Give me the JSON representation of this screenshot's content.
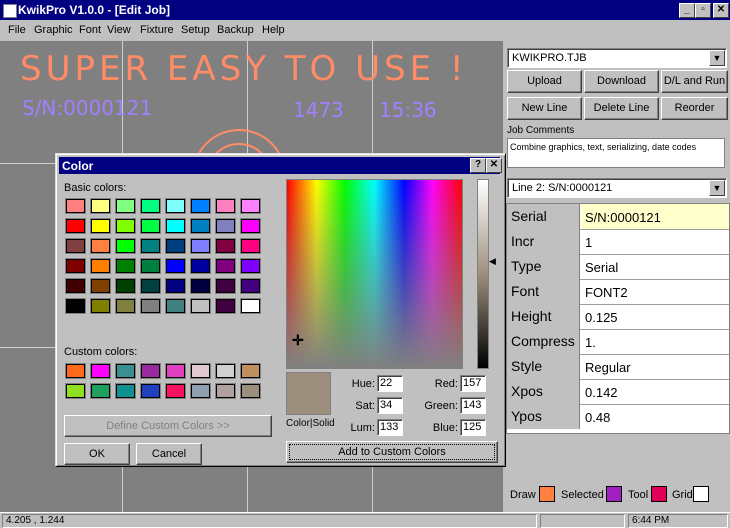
{
  "window": {
    "title": "KwikPro  V1.0.0 - [Edit Job]",
    "controls": [
      "_",
      "\b",
      "X"
    ]
  },
  "menu": [
    "File",
    "Graphic",
    "Font",
    "View",
    "Fixture",
    "Setup",
    "Backup",
    "Help"
  ],
  "canvas": {
    "headline": "SUPER EASY  TO  USE  !",
    "serial_text": "S/N:0000121",
    "count_text": "1473",
    "time_text": "15:36"
  },
  "panel": {
    "file_combo": "KWIKPRO.TJB",
    "buttons": {
      "upload": "Upload",
      "download": "Download",
      "dl_run": "D/L and Run",
      "new_line": "New Line",
      "delete_line": "Delete Line",
      "reorder": "Reorder"
    },
    "job_comments_label": "Job Comments",
    "job_comments": "Combine graphics, text, serializing, date codes",
    "line_combo": "Line 2: S/N:0000121",
    "properties": [
      {
        "name": "Serial",
        "value": "S/N:0000121"
      },
      {
        "name": "Incr",
        "value": "1"
      },
      {
        "name": "Type",
        "value": "Serial"
      },
      {
        "name": "Font",
        "value": "FONT2"
      },
      {
        "name": "Height",
        "value": "0.125"
      },
      {
        "name": "Compress",
        "value": "1."
      },
      {
        "name": "Style",
        "value": "Regular"
      },
      {
        "name": "Xpos",
        "value": "0.142"
      },
      {
        "name": "Ypos",
        "value": "0.48"
      }
    ],
    "legend": {
      "draw": "Draw",
      "selected": "Selected",
      "tool": "Tool",
      "grid": "Grid",
      "draw_color": "#ff8040",
      "selected_color": "#a020c0",
      "tool_color": "#e0005a",
      "grid_color": "#ffffff"
    }
  },
  "color_dialog": {
    "title": "Color",
    "basic_label": "Basic colors:",
    "custom_label": "Custom colors:",
    "basic_colors": [
      "#ff8080",
      "#ffff80",
      "#80ff80",
      "#00ff80",
      "#80ffff",
      "#0080ff",
      "#ff80c0",
      "#ff80ff",
      "#ff0000",
      "#ffff00",
      "#80ff00",
      "#00ff40",
      "#00ffff",
      "#0080c0",
      "#8080c0",
      "#ff00ff",
      "#804040",
      "#ff8040",
      "#00ff00",
      "#008080",
      "#004080",
      "#8080ff",
      "#800040",
      "#ff0080",
      "#800000",
      "#ff8000",
      "#008000",
      "#008040",
      "#0000ff",
      "#0000a0",
      "#800080",
      "#8000ff",
      "#400000",
      "#804000",
      "#004000",
      "#004040",
      "#000080",
      "#000040",
      "#400040",
      "#400080",
      "#000000",
      "#808000",
      "#808040",
      "#808080",
      "#408080",
      "#c0c0c0",
      "#400040",
      "#ffffff"
    ],
    "custom_colors": [
      "#ff6a1a",
      "#ff00ff",
      "#3a9090",
      "#9a2aa0",
      "#e040c0",
      "#e0c8d0",
      "#d0d0d0",
      "#c09060",
      "#90e020",
      "#20a060",
      "#109090",
      "#2040c0",
      "#ff1060",
      "#90a0b0",
      "#b0a0a0",
      "#9d8f7d"
    ],
    "define_button": "Define Custom Colors >>",
    "ok_button": "OK",
    "cancel_button": "Cancel",
    "color_solid_label": "Color|Solid",
    "hue_label": "Hue:",
    "hue": "22",
    "sat_label": "Sat:",
    "sat": "34",
    "lum_label": "Lum:",
    "lum": "133",
    "red_label": "Red:",
    "red": "157",
    "green_label": "Green:",
    "green": "143",
    "blue_label": "Blue:",
    "blue": "125",
    "add_button": "Add to Custom Colors",
    "current_color": "#9d8f7d"
  },
  "status": {
    "coords": "4.205 , 1.244",
    "time": "6:44 PM"
  }
}
